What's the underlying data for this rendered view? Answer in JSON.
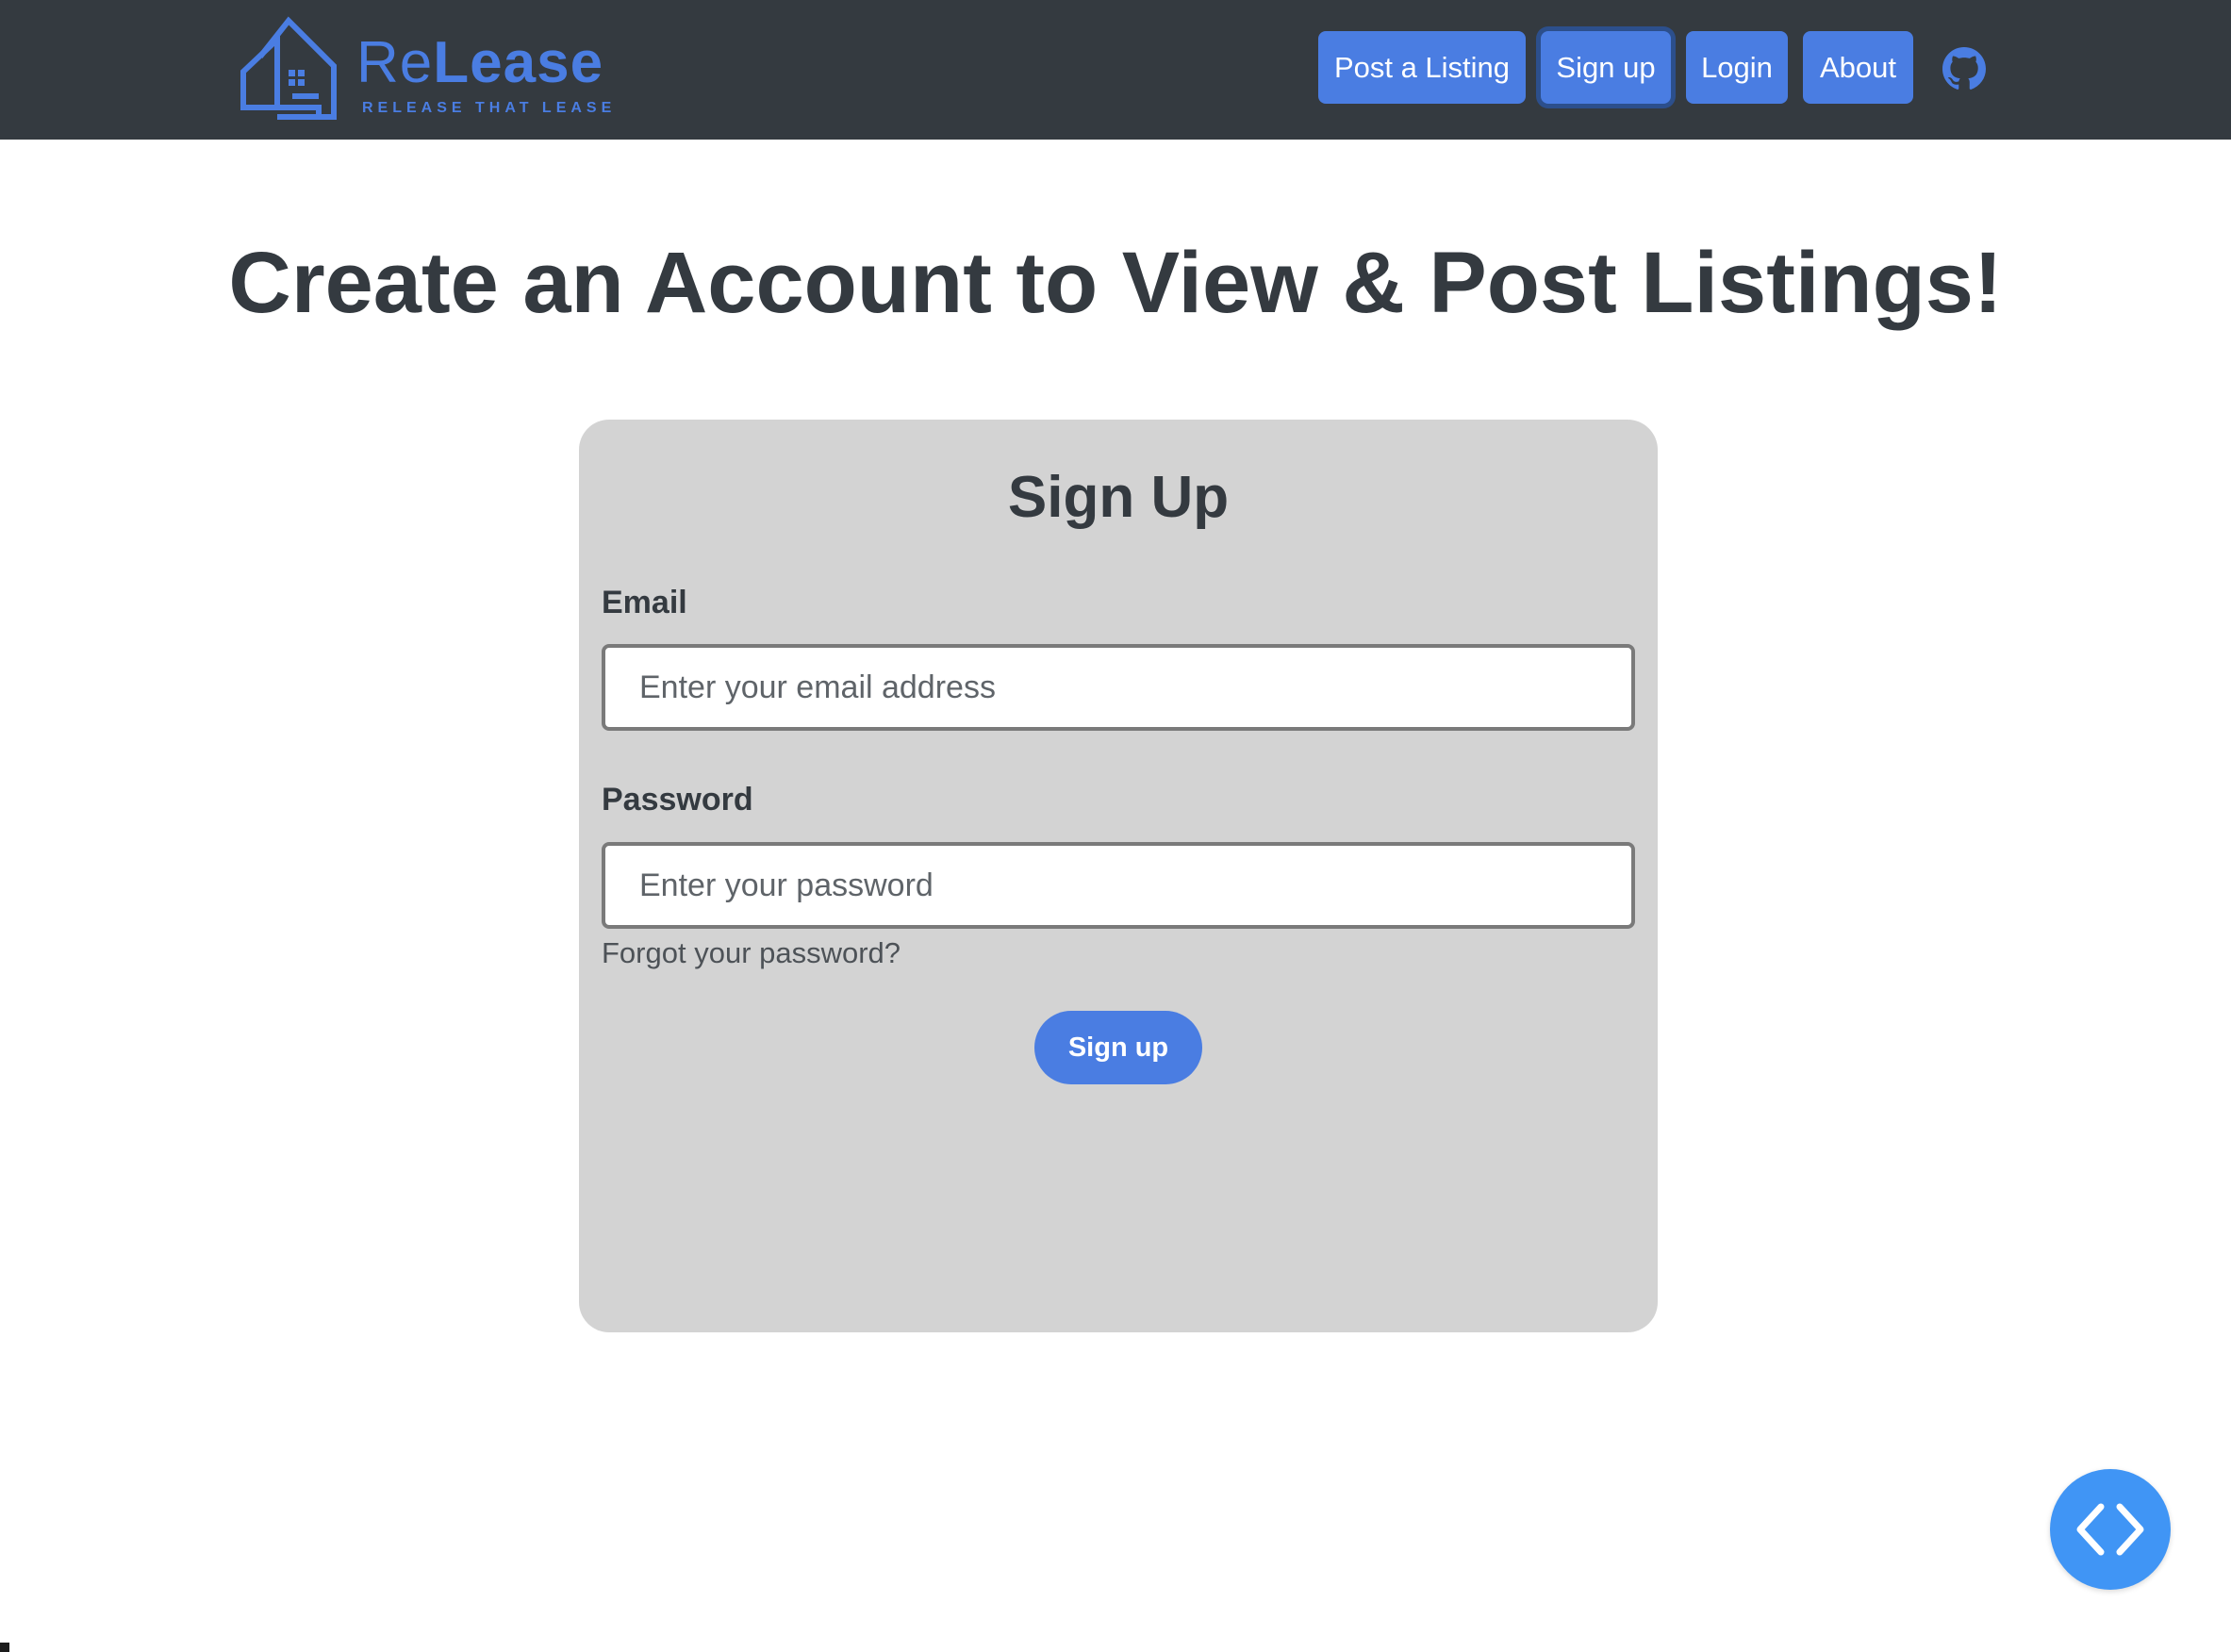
{
  "brand": {
    "name_part1": "Re",
    "name_part2": "Lease",
    "tagline": "RELEASE THAT LEASE",
    "color": "#4a7de2"
  },
  "nav": {
    "items": [
      {
        "label": "Post a Listing"
      },
      {
        "label": "Sign up",
        "active": true
      },
      {
        "label": "Login"
      },
      {
        "label": "About"
      }
    ],
    "github_icon": "github-icon"
  },
  "page": {
    "title": "Create an Account to View & Post Listings!"
  },
  "form": {
    "title": "Sign Up",
    "email_label": "Email",
    "email_placeholder": "Enter your email address",
    "email_value": "",
    "password_label": "Password",
    "password_placeholder": "Enter your password",
    "password_value": "",
    "forgot_label": "Forgot your password?",
    "submit_label": "Sign up"
  },
  "fab": {
    "icon": "code-brackets-icon",
    "color": "#4095f5"
  },
  "colors": {
    "navbar_bg": "#343a40",
    "accent": "#4a7de2",
    "card_bg": "#d3d3d3",
    "text": "#343a40"
  }
}
